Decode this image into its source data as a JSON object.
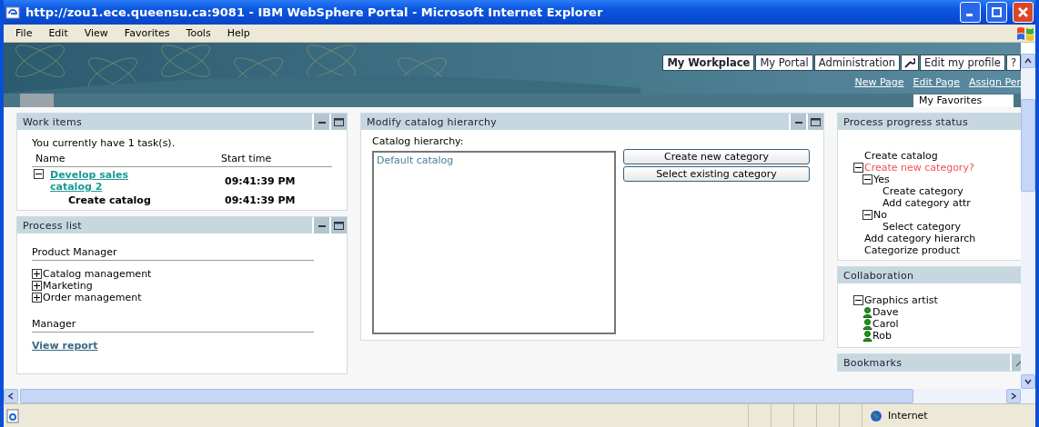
{
  "window": {
    "title": "http://zou1.ece.queensu.ca:9081 - IBM WebSphere Portal - Microsoft Internet Explorer"
  },
  "menu": [
    "File",
    "Edit",
    "View",
    "Favorites",
    "Tools",
    "Help"
  ],
  "top_nav": [
    {
      "kind": "tab",
      "label": "My Workplace",
      "selected": true
    },
    {
      "kind": "tab",
      "label": "My Portal",
      "selected": false
    },
    {
      "kind": "tab",
      "label": "Administration",
      "selected": false
    },
    {
      "kind": "tool"
    },
    {
      "kind": "tab",
      "label": "Edit my profile",
      "selected": false
    },
    {
      "kind": "tab",
      "label": "?",
      "selected": false
    }
  ],
  "page_links": [
    "New Page",
    "Edit Page",
    "Assign Per"
  ],
  "page_tabs": [
    {
      "label": "My Favorites",
      "selected": true
    }
  ],
  "work_items": {
    "title": "Work items",
    "summary": "You currently have 1 task(s).",
    "columns": [
      "Name",
      "Start time"
    ],
    "tasks": [
      {
        "name": "Develop sales catalog 2",
        "time": "09:41:39 PM",
        "expanded": true,
        "children": [
          {
            "name": "Create catalog",
            "time": "09:41:39 PM"
          }
        ]
      }
    ]
  },
  "process_list": {
    "title": "Process list",
    "groups": [
      {
        "heading": "Product Manager",
        "items": [
          {
            "kind": "process",
            "label": "Catalog management",
            "expanded": false
          },
          {
            "kind": "process",
            "label": "Marketing",
            "expanded": false
          },
          {
            "kind": "process",
            "label": "Order management",
            "expanded": false
          }
        ]
      },
      {
        "heading": "Manager",
        "items": [
          {
            "kind": "link",
            "label": "View report"
          }
        ]
      }
    ]
  },
  "modify": {
    "title": "Modify catalog hierarchy",
    "field_label": "Catalog hierarchy:",
    "list_items": [
      "Default catalog"
    ],
    "buttons": [
      "Create new category",
      "Select existing category"
    ]
  },
  "progress": {
    "title": "Process progress status",
    "steps": [
      {
        "label": "Create catalog",
        "current": false
      },
      {
        "label": "Create new category?",
        "current": true,
        "expanded": true,
        "children": [
          {
            "label": "Yes",
            "current": false,
            "expanded": true,
            "children": [
              {
                "label": "Create category",
                "current": false
              },
              {
                "label": "Add category attr",
                "current": false
              }
            ]
          },
          {
            "label": "No",
            "current": false,
            "expanded": true,
            "children": [
              {
                "label": "Select category",
                "current": false
              }
            ]
          }
        ]
      },
      {
        "label": "Add category hierarch",
        "current": false
      },
      {
        "label": "Categorize product",
        "current": false
      }
    ]
  },
  "collaboration": {
    "title": "Collaboration",
    "groups": [
      {
        "label": "Graphics artist",
        "expanded": true,
        "members": [
          "Dave",
          "Carol",
          "Rob"
        ]
      }
    ]
  },
  "bookmarks": {
    "title": "Bookmarks"
  },
  "status_bar": {
    "zone": "Internet"
  }
}
